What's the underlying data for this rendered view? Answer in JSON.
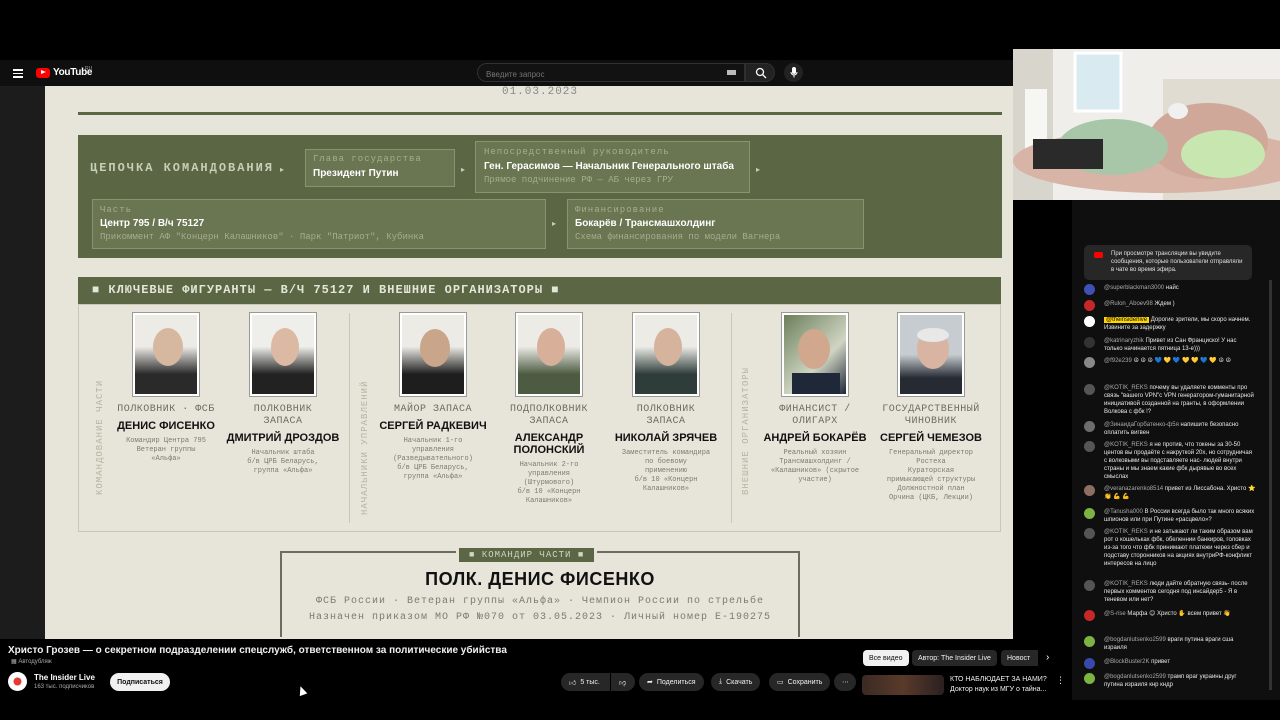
{
  "header": {
    "logo_text": "YouTube",
    "logo_region": "RU",
    "search_placeholder": "Введите запрос"
  },
  "video": {
    "date": "01.03.2023",
    "command_chain": {
      "title": "ЦЕПОЧКА КОМАНДОВАНИЯ",
      "boxes": [
        {
          "label": "Глава государства",
          "value": "Президент Путин",
          "sub": ""
        },
        {
          "label": "Непосредственный руководитель",
          "value": "Ген. Герасимов — Начальник Генерального штаба",
          "sub": "Прямое подчинение РФ — АБ через ГРУ"
        },
        {
          "label": "Часть",
          "value": "Центр 795 / В/ч 75127",
          "sub": "Прикоммент АФ \"Концерн Калашников\" · Парк \"Патриот\", Кубинка"
        },
        {
          "label": "Финансирование",
          "value": "Бокарёв / Трансмашхолдинг",
          "sub": "Схема финансирования по модели Вагнера"
        }
      ]
    },
    "key_figures_title": "КЛЮЧЕВЫЕ ФИГУРАНТЫ — В/Ч 75127 И ВНЕШНИЕ ОРГАНИЗАТОРЫ",
    "group_labels": [
      "КОМАНДОВАНИЕ ЧАСТИ",
      "НАЧАЛЬНИКИ УПРАВЛЕНИЙ",
      "ВНЕШНИЕ ОРГАНИЗАТОРЫ"
    ],
    "people": [
      {
        "role": "ПОЛКОВНИК · ФСБ",
        "name": "ДЕНИС ФИСЕНКО",
        "desc": "Командир Центра 795\nВетеран группы\n«Альфа»"
      },
      {
        "role": "ПОЛКОВНИК\nЗАПАСА",
        "name": "ДМИТРИЙ ДРОЗДОВ",
        "desc": "Начальник штаба\nб/в ЦРБ Беларусь,\nгруппа «Альфа»"
      },
      {
        "role": "МАЙОР ЗАПАСА",
        "name": "СЕРГЕЙ РАДКЕВИЧ",
        "desc": "Начальник 1-го\nуправления\n(Разведывательного)\nб/в ЦРБ Беларусь,\nгруппа «Альфа»"
      },
      {
        "role": "ПОДПОЛКОВНИК\nЗАПАСА",
        "name": "АЛЕКСАНДР\nПОЛОНСКИЙ",
        "desc": "Начальник 2-го\nуправления\n(Штурмового)\nб/в 10 «Концерн\nКалашников»"
      },
      {
        "role": "ПОЛКОВНИК\nЗАПАСА",
        "name": "НИКОЛАЙ ЗРЯЧЕВ",
        "desc": "Заместитель командира\nпо боевому\nприменению\nб/в 10 «Концерн\nКалашников»"
      },
      {
        "role": "ФИНАНСИСТ /\nОЛИГАРХ",
        "name": "АНДРЕЙ БОКАРЁВ",
        "desc": "Реальный хозяин\nТрансмашхолдинг /\n«Калашников» (скрытое\nучастие)"
      },
      {
        "role": "ГОСУДАРСТВЕННЫЙ\nЧИНОВНИК",
        "name": "СЕРГЕЙ ЧЕМЕЗОВ",
        "desc": "Генеральный директор\nРостеха\nКураторская\nпримыкающей структуры\nДолжностной план\nОрчина (ЦКБ, Лекции)"
      }
    ],
    "commander": {
      "badge": "КОМАНДИР ЧАСТИ",
      "name": "ПОЛК. ДЕНИС ФИСЕНКО",
      "line1": "ФСБ России · Ветеран группы «Альфа» · Чемпион России по стрельбе",
      "line2": "Назначен приказом МО РФ №070 от 03.05.2023 · Личный номер Е-190275"
    }
  },
  "meta": {
    "title": "Христо Грозев — о секретном подразделении спецслужб, ответственном за политические убийства",
    "tag": "Автодубляж",
    "channel_name": "The Insider Live",
    "subscribers": "163 тыс. подписчиков",
    "subscribe_label": "Подписаться",
    "likes": "5 тыс.",
    "share_label": "Поделиться",
    "download_label": "Скачать",
    "save_label": "Сохранить",
    "chips": [
      "Все видео",
      "Автор: The Insider Live",
      "Новост"
    ],
    "rec_title": "КТО НАБЛЮДАЕТ ЗА НАМИ? Доктор наук из МГУ о тайна..."
  },
  "chat": {
    "notice": "При просмотре трансляции вы увидите сообщения, которые пользователи отправляли в чате во время эфира.",
    "messages": [
      {
        "author": "@superblackman3000",
        "text": "найс",
        "color": "#3f51b5"
      },
      {
        "author": "@Rulon_Aboev98",
        "text": "Ждем )",
        "color": "#c62828"
      },
      {
        "author": "@theinsiderlive",
        "text": "Дорогие зрители, мы скоро начнем. Извините за задержку",
        "color": "#ffffff",
        "owner": true
      },
      {
        "author": "@katrinaryzhik",
        "text": "Привет из Сан Франциско! У нас только начинается пятница 13-е)))",
        "color": "#333333"
      },
      {
        "author": "@f92e239",
        "text": "☮ ☮ ☮ 💙 💛 💙 💛 💛 💙 💛 ☮ ☮",
        "color": "#888888"
      },
      {
        "author": "@KOTIK_REKS",
        "text": "почему вы удаляете комменты про связь \"вашего VPN\"с VPN генератором-гуманитарной инициативой созданной на гранты, в оформлении Волкова с фбк !?",
        "color": "#555555"
      },
      {
        "author": "@ЗинаидаГорбатенко-ф5я",
        "text": "напишите безопасно оплатить вигвен",
        "color": "#6d6d6d"
      },
      {
        "author": "@KOTIK_REKS",
        "text": "я не против, что токены за 30-50 центов вы продаёте с накруткой 20х, но сотрудничая с волковыми вы подставляете нас- людей внутри страны и мы знаем какие фбк дырявые во всех смыслах",
        "color": "#555555"
      },
      {
        "author": "@veranazarenko8514",
        "text": "привет из Лиссабона. Христо ⭐ 👏 💪 💪",
        "color": "#8d6e63"
      },
      {
        "author": "@Tanusha000",
        "text": "В России всегда было так много всяких шпионов или при Путине «расцвело»?",
        "color": "#7cb342"
      },
      {
        "author": "@KOTIK_REKS",
        "text": "и не затыкают ли таким образом вам рот о кошельках фбк, обеленнии банкиров, головках из-за того что фбк принимают платежи через сбер и подставу сторонников на акциях внутриРФ-конфликт интересов на лицо",
        "color": "#555555"
      },
      {
        "author": "@KOTIK_REKS",
        "text": "люди дайте обратную связь- после первых комментов сегодня под инсайдер5 - Я в теневом или нет?",
        "color": "#555555"
      },
      {
        "author": "@S-rise",
        "text": "Марфа 😊 Христо ✋ всем привет 👋",
        "color": "#c62828"
      },
      {
        "author": "@bogdanlutsenko2599",
        "text": "враги путина враги сша израиля",
        "color": "#7cb342"
      },
      {
        "author": "@BlockBuster2K",
        "text": "привет",
        "color": "#3949ab"
      },
      {
        "author": "@bogdanlutsenko2599",
        "text": "трамп враг украины друг путина израиля кнр кндр",
        "color": "#7cb342"
      }
    ]
  },
  "colors": {
    "olive": "#5b6644",
    "paper": "#e7e5da",
    "yt_red": "#ff0000",
    "chat_bg": "#0f0f0f"
  }
}
